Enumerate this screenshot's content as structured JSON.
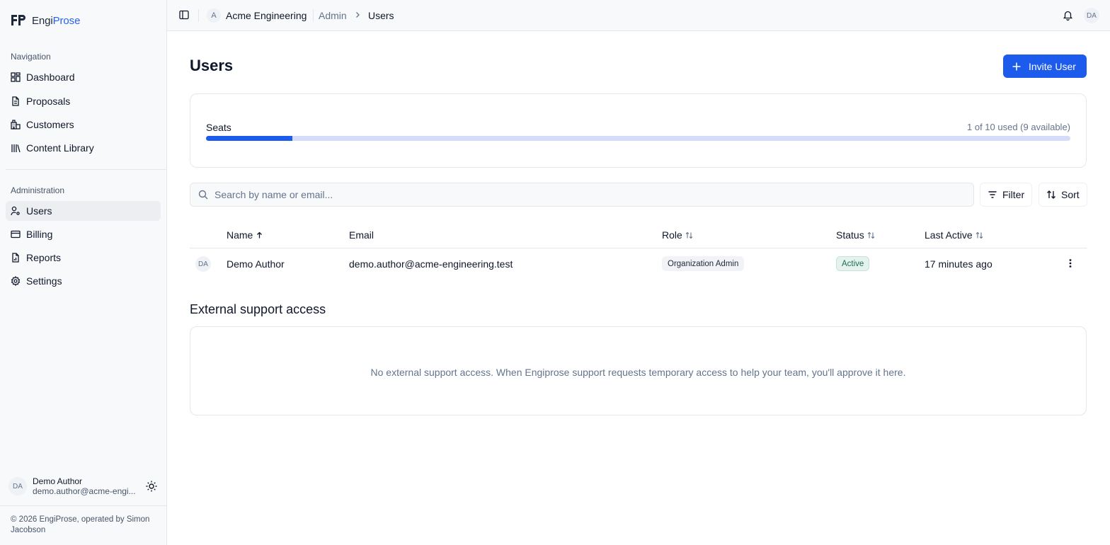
{
  "brand": {
    "prefix": "Engi",
    "accent": "Prose",
    "color": "#2563eb"
  },
  "sidebar": {
    "navigation_label": "Navigation",
    "navigation": [
      {
        "label": "Dashboard",
        "icon": "dashboard-icon"
      },
      {
        "label": "Proposals",
        "icon": "document-icon"
      },
      {
        "label": "Customers",
        "icon": "building-icon"
      },
      {
        "label": "Content Library",
        "icon": "library-icon"
      }
    ],
    "administration_label": "Administration",
    "administration": [
      {
        "label": "Users",
        "icon": "user-cog-icon",
        "active": true
      },
      {
        "label": "Billing",
        "icon": "credit-card-icon"
      },
      {
        "label": "Reports",
        "icon": "report-icon"
      },
      {
        "label": "Settings",
        "icon": "gear-icon"
      }
    ],
    "user": {
      "initials": "DA",
      "name": "Demo Author",
      "email": "demo.author@acme-engi..."
    },
    "copyright": "© 2026 EngiProse, operated by Simon Jacobson"
  },
  "topbar": {
    "org_initial": "A",
    "org_name": "Acme Engineering",
    "breadcrumb": [
      "Admin",
      "Users"
    ],
    "user_initials": "DA"
  },
  "page": {
    "title": "Users",
    "invite_label": "Invite User",
    "accent_color": "#1d5bec"
  },
  "seats": {
    "label": "Seats",
    "usage_text": "1 of 10 used (9 available)",
    "used": 1,
    "total": 10
  },
  "search": {
    "placeholder": "Search by name or email..."
  },
  "toolbar": {
    "filter_label": "Filter",
    "sort_label": "Sort"
  },
  "table": {
    "columns": [
      "Name",
      "Email",
      "Role",
      "Status",
      "Last Active"
    ],
    "rows": [
      {
        "initials": "DA",
        "name": "Demo Author",
        "email": "demo.author@acme-engineering.test",
        "role": "Organization Admin",
        "status": "Active",
        "last_active": "17 minutes ago"
      }
    ]
  },
  "support": {
    "title": "External support access",
    "empty_text": "No external support access. When Engiprose support requests temporary access to help your team, you'll approve it here."
  }
}
